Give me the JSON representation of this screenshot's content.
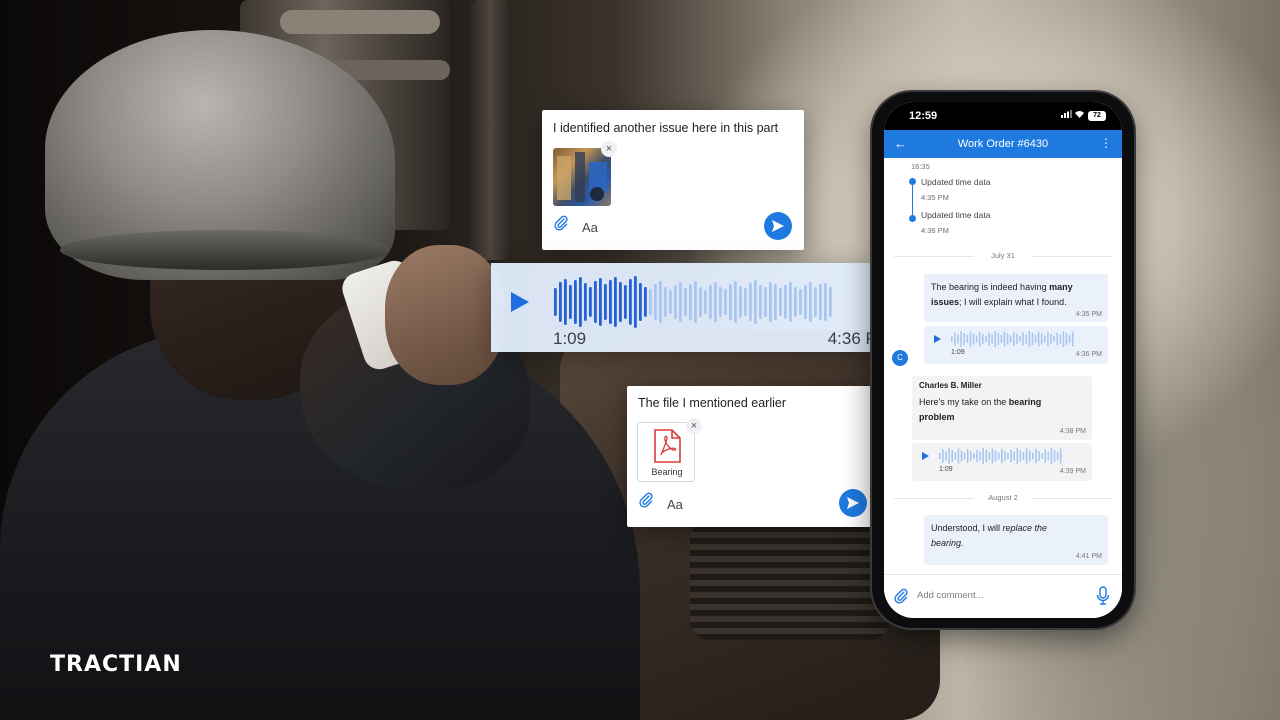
{
  "brand": {
    "logo_text": "TRACTIAN",
    "accent": "#1f7ae0"
  },
  "card_photo": {
    "message": "I identified another issue here in this part",
    "remove_icon": "×",
    "format_label": "Aa"
  },
  "audio_strip": {
    "duration": "1:09",
    "time": "4:36 PM"
  },
  "card_file": {
    "message": "The file I mentioned earlier",
    "file_name": "Bearing",
    "remove_icon": "×",
    "format_label": "Aa"
  },
  "phone": {
    "status": {
      "time": "12:59",
      "battery": "72"
    },
    "appbar": {
      "back_icon": "←",
      "title": "Work Order #6430",
      "menu_icon": "⋮"
    },
    "timeline": {
      "top_time": "16:35",
      "events": [
        {
          "label": "Updated time data",
          "time": "4:35 PM"
        },
        {
          "label": "Updated time data",
          "time": "4:36 PM"
        }
      ]
    },
    "date_july": "July 31",
    "msg1": {
      "text_a": "The bearing is indeed having ",
      "bold_a": "many",
      "bold_b": "issues",
      "text_b": "; I will explain what I found.",
      "time": "4:35 PM"
    },
    "audio1": {
      "duration": "1:09",
      "time": "4:36 PM"
    },
    "msg2": {
      "avatar": "C",
      "sender": "Charles B. Miller",
      "text_a": "Here's my take on the ",
      "bold_a": "bearing",
      "bold_b": "problem",
      "time": "4:38 PM"
    },
    "audio2": {
      "duration": "1:09",
      "time": "4:39 PM"
    },
    "date_aug": "August 2",
    "msg3": {
      "text_a": "Understood, I will ",
      "italic_a": "replace the",
      "italic_b": "bearing.",
      "time": "4:41 PM"
    },
    "input": {
      "placeholder": "Add comment..."
    }
  }
}
